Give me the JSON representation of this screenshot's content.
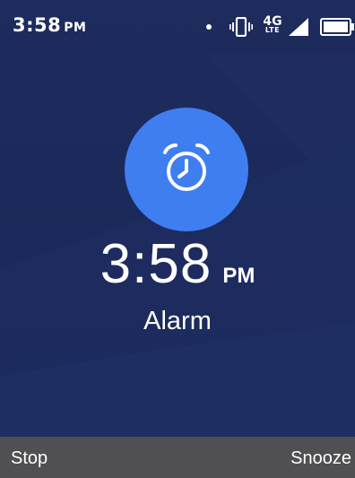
{
  "status_bar": {
    "time": "3:58",
    "ampm": "PM",
    "network_g": "4G",
    "network_lte": "LTE",
    "icons": [
      "notification-dot",
      "vibrate-icon",
      "signal-icon",
      "battery-icon"
    ]
  },
  "alarm": {
    "icon": "alarm-clock-icon",
    "time": "3:58",
    "ampm": "PM",
    "label": "Alarm"
  },
  "softkeys": {
    "left": "Stop",
    "right": "Snooze"
  },
  "colors": {
    "background": "#1b2a5a",
    "accent": "#3f7ef0",
    "softkey_bar": "#505052",
    "text": "#ffffff"
  }
}
